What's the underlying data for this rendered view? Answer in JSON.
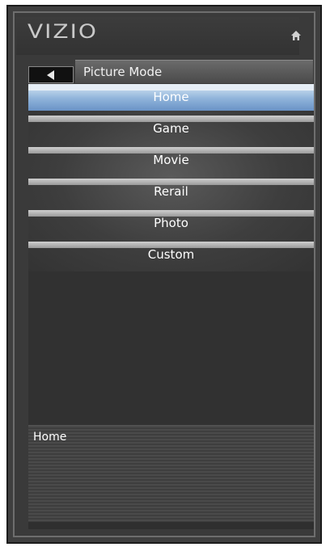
{
  "header": {
    "logo_text": "VIZIO",
    "home_icon": "home-icon"
  },
  "titlebar": {
    "back_icon": "back-arrow-icon",
    "title": "Picture Mode"
  },
  "menu": {
    "selected_index": 0,
    "items": [
      {
        "label": "Home"
      },
      {
        "label": "Game"
      },
      {
        "label": "Movie"
      },
      {
        "label": "Rerail"
      },
      {
        "label": "Photo"
      },
      {
        "label": "Custom"
      }
    ]
  },
  "info": {
    "text": "Home"
  },
  "colors": {
    "selected_highlight": "#8fb3da",
    "panel_background": "#3a3a3a"
  }
}
